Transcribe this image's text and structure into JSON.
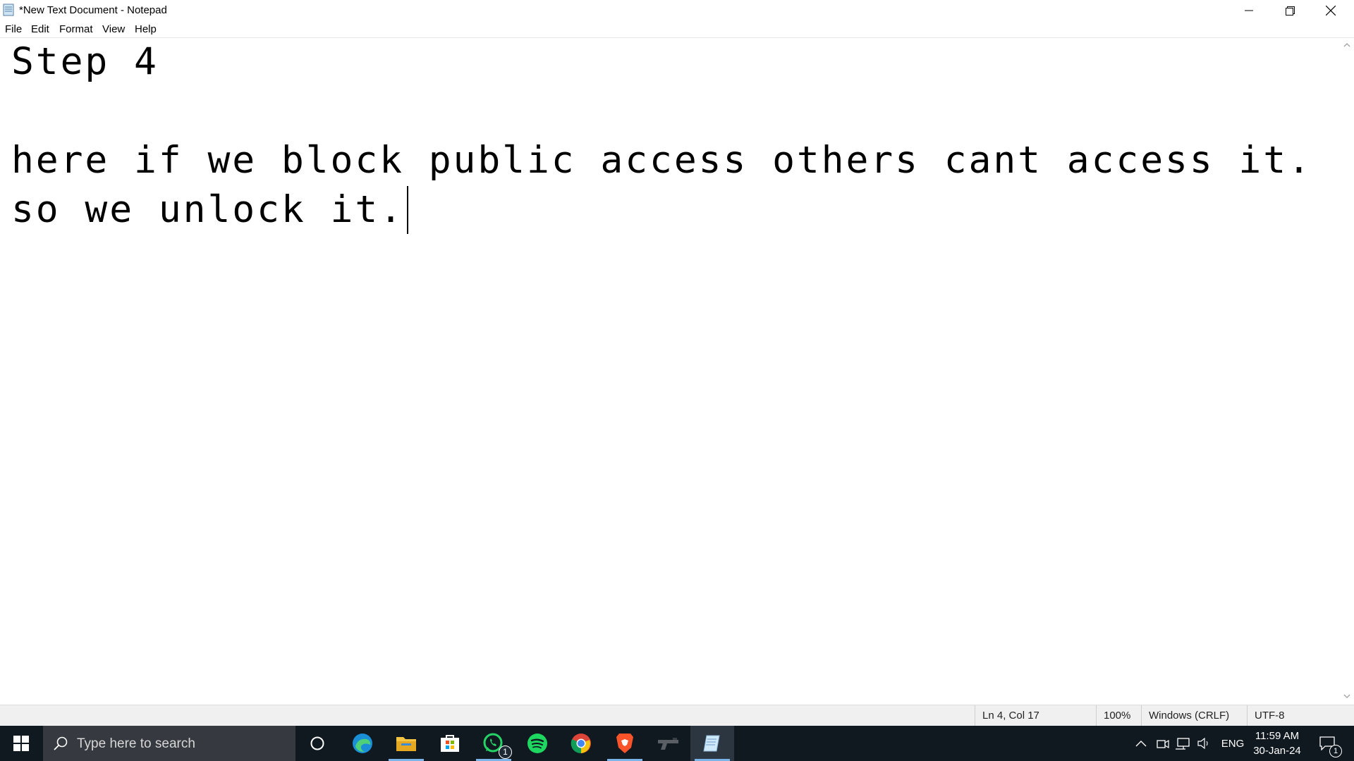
{
  "window": {
    "title": "*New Text Document - Notepad",
    "minimize_icon": "minimize-icon",
    "maximize_icon": "restore-icon",
    "close_icon": "close-icon"
  },
  "menu": {
    "file": "File",
    "edit": "Edit",
    "format": "Format",
    "view": "View",
    "help": "Help"
  },
  "editor": {
    "lines": [
      "Step 4",
      "",
      "here if we block public access others cant access it.",
      "so we unlock it."
    ]
  },
  "status": {
    "position": "Ln 4, Col 17",
    "zoom": "100%",
    "line_ending": "Windows (CRLF)",
    "encoding": "UTF-8"
  },
  "taskbar": {
    "search_placeholder": "Type here to search",
    "apps": [
      "cortana",
      "edge",
      "file-explorer",
      "microsoft-store",
      "whatsapp",
      "spotify",
      "chrome",
      "brave",
      "gun-app",
      "notepad"
    ],
    "whatsapp_badge": "1",
    "language": "ENG",
    "time": "11:59 AM",
    "date": "30-Jan-24",
    "notification_badge": "1"
  },
  "colors": {
    "taskbar_bg": "#101820",
    "search_bg": "#363a40",
    "active_indicator": "#7ab4e8"
  }
}
